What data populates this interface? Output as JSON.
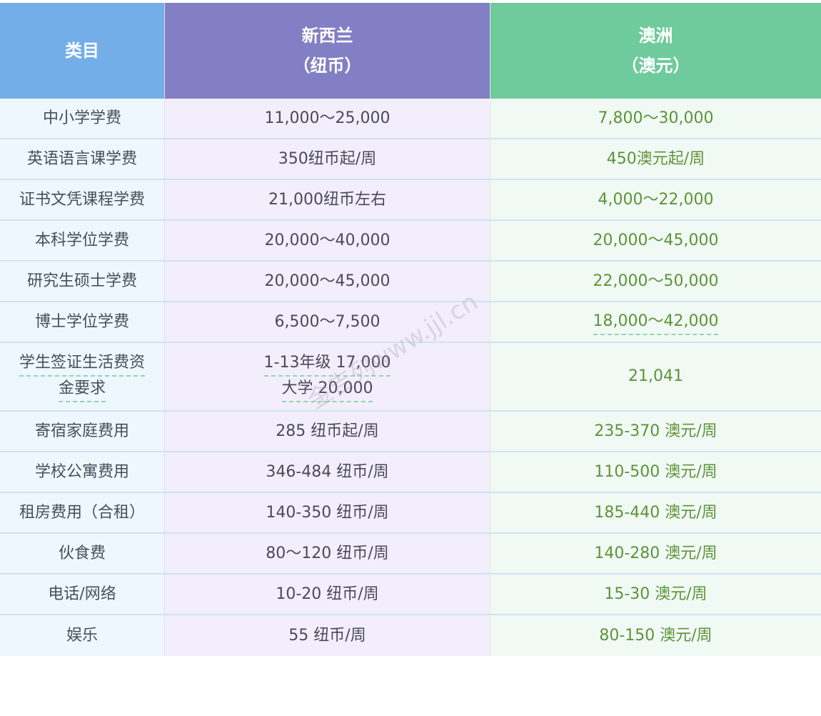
{
  "header": {
    "col1": "类目",
    "col2_line1": "新西兰",
    "col2_line2": "（纽币）",
    "col3_line1": "澳洲",
    "col3_line2": "（澳元）"
  },
  "rows": [
    {
      "category": "中小学学费",
      "nz": "11,000～25,000",
      "au": "7,800～30,000"
    },
    {
      "category": "英语语言课学费",
      "nz": "350纽币起/周",
      "au": "450澳元起/周"
    },
    {
      "category": "证书文凭课程学费",
      "nz": "21,000纽币左右",
      "au": "4,000～22,000"
    },
    {
      "category": "本科学位学费",
      "nz": "20,000～40,000",
      "au": "20,000～45,000"
    },
    {
      "category": "研究生硕士学费",
      "nz": "20,000～45,000",
      "au": "22,000～50,000"
    },
    {
      "category": "博士学位学费",
      "nz": "6,500～7,500",
      "au": "18,000～42,000"
    },
    {
      "category_line1": "学生签证生活费资",
      "category_line2": "金要求",
      "nz_line1": "1-13年级 17,000",
      "nz_line2": "大学 20,000",
      "au": "21,041"
    },
    {
      "category": "寄宿家庭费用",
      "nz": "285 纽币起/周",
      "au": "235-370 澳元/周"
    },
    {
      "category": "学校公寓费用",
      "nz": "346-484 纽币/周",
      "au": "110-500 澳元/周"
    },
    {
      "category": "租房费用（合租）",
      "nz": "140-350 纽币/周",
      "au": "185-440 澳元/周"
    },
    {
      "category": "伙食费",
      "nz": "80～120 纽币/周",
      "au": "140-280 澳元/周"
    },
    {
      "category": "电话/网络",
      "nz": "10-20 纽币/周",
      "au": "15-30 澳元/周"
    },
    {
      "category": "娱乐",
      "nz": "55 纽币/周",
      "au": "80-150 澳元/周"
    }
  ],
  "watermark": "金吉列www.jjl.cn"
}
